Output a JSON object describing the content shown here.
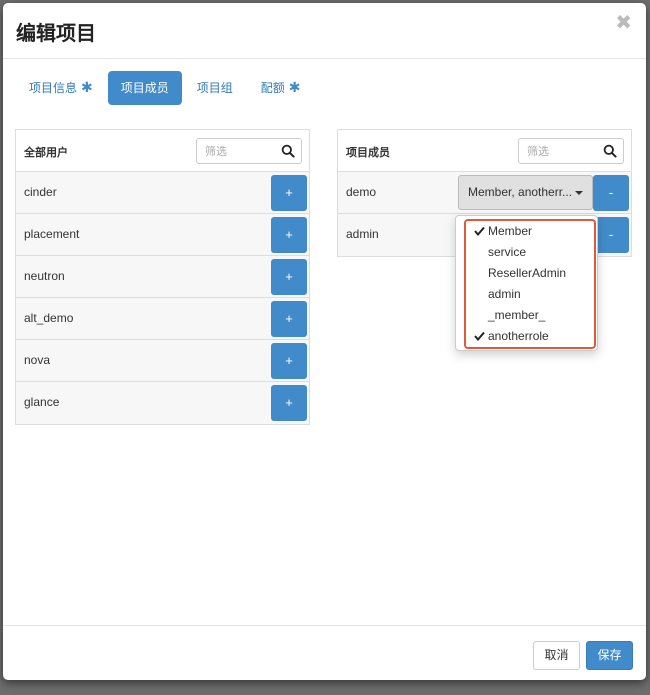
{
  "dialog": {
    "title": "编辑项目",
    "close_glyph": "✖"
  },
  "tabs": [
    {
      "label": "项目信息",
      "required": true,
      "active": false
    },
    {
      "label": "项目成员",
      "required": false,
      "active": true
    },
    {
      "label": "项目组",
      "required": false,
      "active": false
    },
    {
      "label": "配额",
      "required": true,
      "active": false
    }
  ],
  "required_mark": "✱",
  "all_users": {
    "title": "全部用户",
    "filter_placeholder": "筛选",
    "add_label": "+",
    "users": [
      "cinder",
      "placement",
      "neutron",
      "alt_demo",
      "nova",
      "glance"
    ]
  },
  "project_members": {
    "title": "项目成员",
    "filter_placeholder": "筛选",
    "remove_label": "-",
    "members": [
      {
        "name": "demo",
        "roles_display": "Member, anotherr..."
      },
      {
        "name": "admin",
        "roles_display": ""
      }
    ]
  },
  "role_dropdown": {
    "options": [
      {
        "label": "Member",
        "checked": true
      },
      {
        "label": "service",
        "checked": false
      },
      {
        "label": "ResellerAdmin",
        "checked": false
      },
      {
        "label": "admin",
        "checked": false
      },
      {
        "label": "_member_",
        "checked": false
      },
      {
        "label": "anotherrole",
        "checked": true
      }
    ]
  },
  "footer": {
    "cancel_label": "取消",
    "save_label": "保存"
  },
  "colors": {
    "primary": "#428bca",
    "highlight": "#e05a38"
  }
}
